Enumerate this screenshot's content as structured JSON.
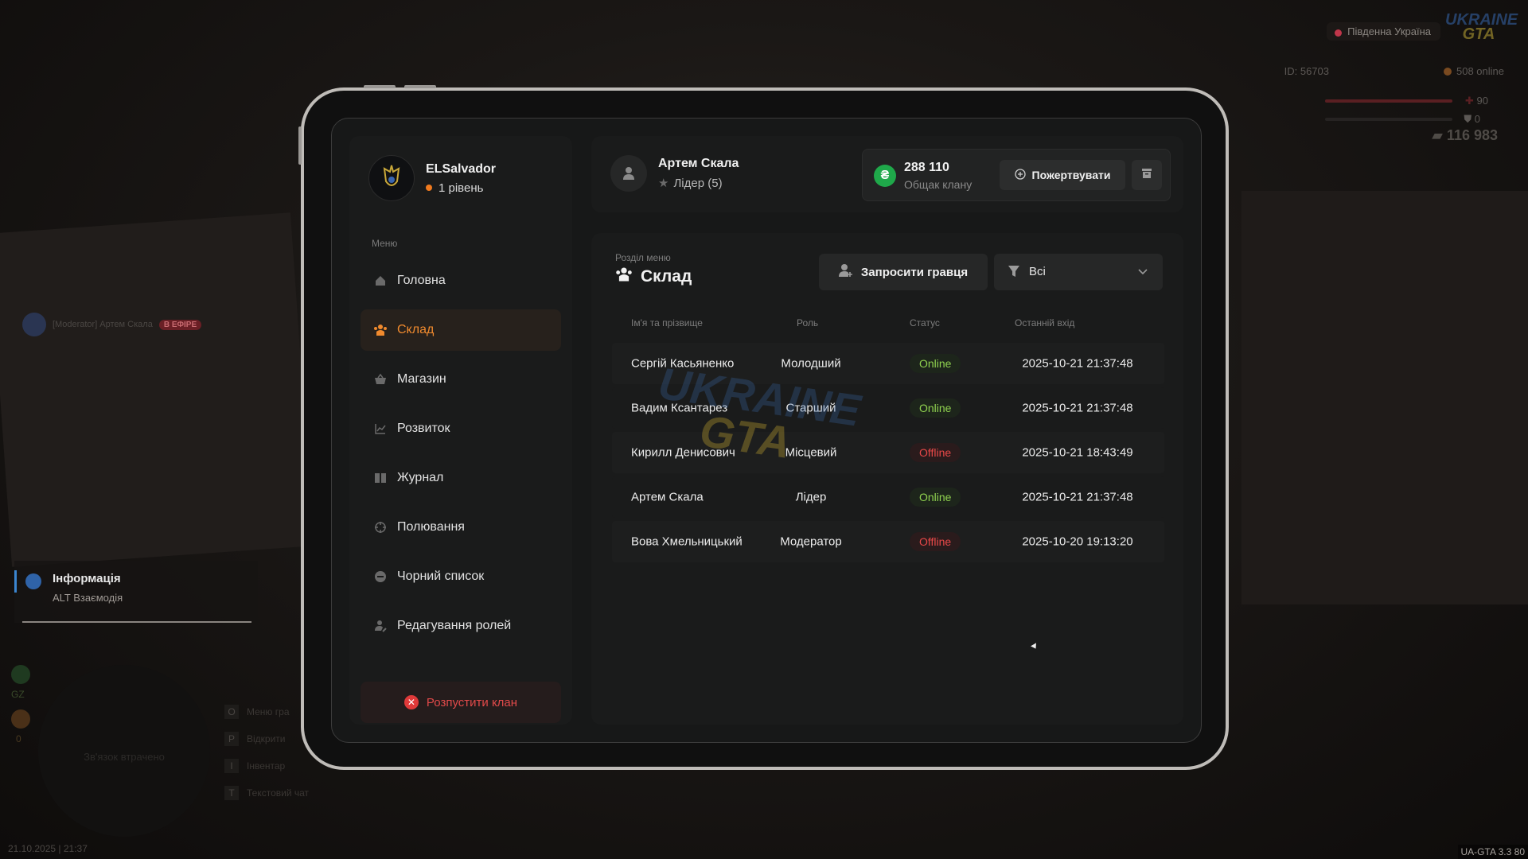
{
  "hud": {
    "region": "Південна Україна",
    "logo_top": "UKRAINE",
    "logo_bottom": "GTA",
    "player_id": "ID: 56703",
    "online": "508 online",
    "health": "90",
    "armor": "0",
    "money": "116 983",
    "stream_name": "[Moderator] Артем Скала",
    "stream_badge": "В ЕФІРЕ",
    "info_title": "Інформація",
    "info_subtitle": "ALT Взаємодія",
    "radar_text": "Зв'язок втрачено",
    "side_gz": "GZ",
    "side_zero": "0",
    "keys": [
      {
        "key": "O",
        "label": "Меню гра"
      },
      {
        "key": "P",
        "label": "Відкрити"
      },
      {
        "key": "I",
        "label": "Інвентар"
      },
      {
        "key": "T",
        "label": "Текстовий чат"
      }
    ],
    "datetime": "21.10.2025 | 21:37",
    "version": "UA-GTA 3.3   80"
  },
  "clan": {
    "name": "ELSalvador",
    "level": "1 рівень"
  },
  "menu": {
    "caption": "Меню",
    "items": [
      {
        "label": "Головна",
        "icon": "home-icon"
      },
      {
        "label": "Склад",
        "icon": "users-icon"
      },
      {
        "label": "Магазин",
        "icon": "basket-icon"
      },
      {
        "label": "Розвиток",
        "icon": "chart-icon"
      },
      {
        "label": "Журнал",
        "icon": "book-icon"
      },
      {
        "label": "Полювання",
        "icon": "crosshair-icon"
      },
      {
        "label": "Чорний список",
        "icon": "minus-circle-icon"
      },
      {
        "label": "Редагування ролей",
        "icon": "user-edit-icon"
      }
    ],
    "active_index": 1,
    "disband_label": "Розпустити клан"
  },
  "user": {
    "name": "Артем Скала",
    "role": "Лідер (5)"
  },
  "bank": {
    "currency_symbol": "₴",
    "value": "288 110",
    "caption": "Общак клану",
    "donate_label": "Пожертвувати"
  },
  "section": {
    "caption": "Розділ меню",
    "title": "Склад",
    "invite_label": "Запросити гравця",
    "filter_value": "Всі"
  },
  "table": {
    "headers": [
      "Ім'я та прізвище",
      "Роль",
      "Статус",
      "Останній вхід"
    ],
    "rows": [
      {
        "name": "Сергій Касьяненко",
        "role": "Молодший",
        "status": "Online",
        "last": "2025-10-21 21:37:48"
      },
      {
        "name": "Вадим Ксантарез",
        "role": "Старший",
        "status": "Online",
        "last": "2025-10-21 21:37:48"
      },
      {
        "name": "Кирилл Денисович",
        "role": "Місцевий",
        "status": "Offline",
        "last": "2025-10-21 18:43:49"
      },
      {
        "name": "Артем Скала",
        "role": "Лідер",
        "status": "Online",
        "last": "2025-10-21 21:37:48"
      },
      {
        "name": "Вова Хмельницький",
        "role": "Модератор",
        "status": "Offline",
        "last": "2025-10-20 19:13:20"
      }
    ]
  },
  "colors": {
    "accent": "#f08a2e",
    "online": "#8fd14f",
    "offline": "#e84848",
    "coin": "#1fa84a",
    "danger": "#e03a3a"
  }
}
